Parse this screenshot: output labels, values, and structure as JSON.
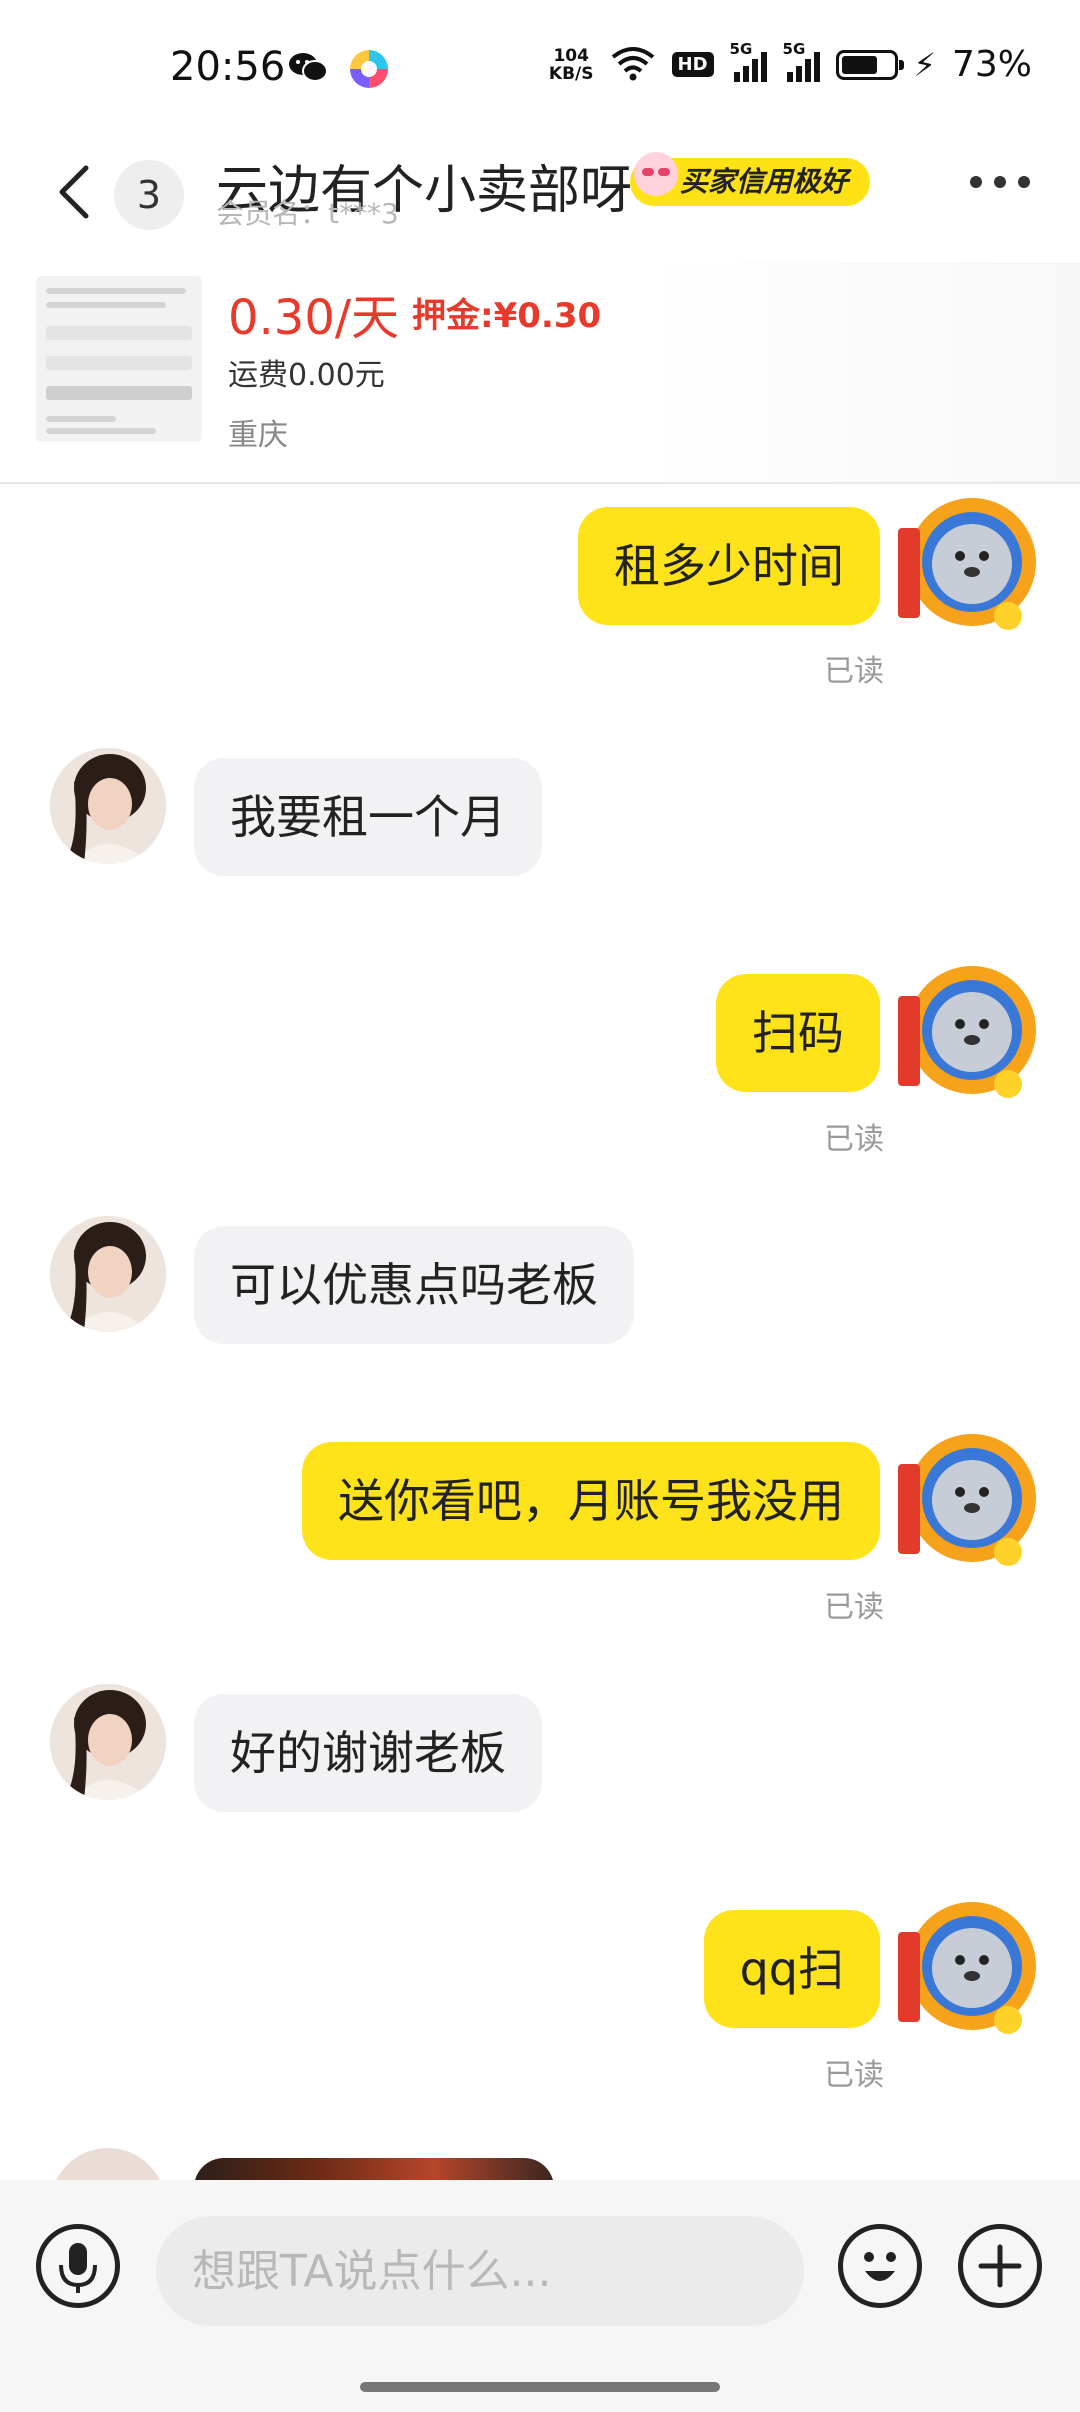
{
  "status_bar": {
    "time": "20:56",
    "net_speed_value": "104",
    "net_speed_unit": "KB/S",
    "hd": "HD",
    "sim1": "5G",
    "sim2": "5G",
    "battery_pct": "73%",
    "battery_level": 0.73,
    "app_icons": [
      "wechat-icon",
      "colorful-ball-icon"
    ]
  },
  "header": {
    "unread_count": "3",
    "title": "云边有个小卖部呀",
    "badge": "买家信用极好",
    "member_label": "会员名：t***3"
  },
  "product": {
    "price": "0.30/天",
    "deposit": "押金:¥0.30",
    "shipping": "运费0.00元",
    "location": "重庆"
  },
  "messages": [
    {
      "from": "me",
      "text": "租多少时间",
      "status": "已读"
    },
    {
      "from": "other",
      "text": "我要租一个月"
    },
    {
      "from": "me",
      "text": "扫码",
      "status": "已读"
    },
    {
      "from": "other",
      "text": "可以优惠点吗老板"
    },
    {
      "from": "me",
      "text": "送你看吧，月账号我没用",
      "status": "已读"
    },
    {
      "from": "other",
      "text": "好的谢谢老板"
    },
    {
      "from": "me",
      "text": "qq扫",
      "status": "已读"
    }
  ],
  "input": {
    "placeholder": "想跟TA说点什么..."
  },
  "colors": {
    "accent_yellow": "#ffe31a",
    "price_red": "#e8392a",
    "bubble_gray": "#f2f2f4"
  }
}
